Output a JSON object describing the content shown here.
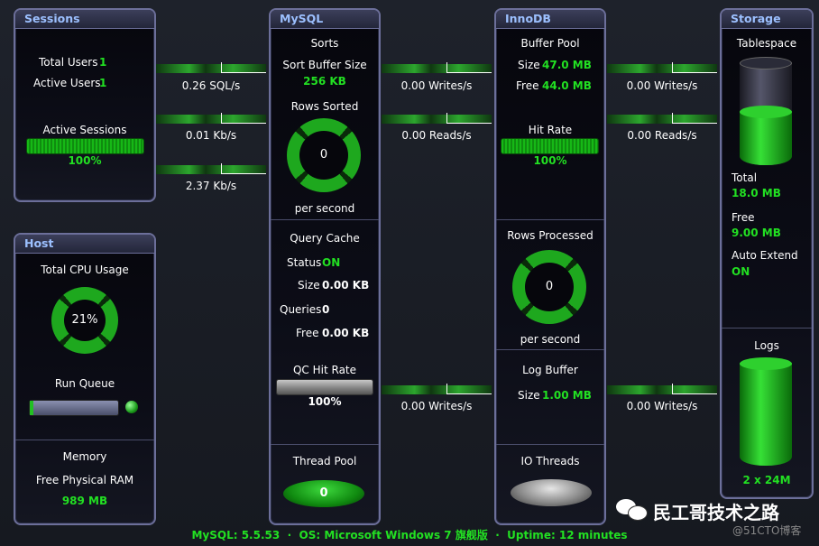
{
  "sessions": {
    "title": "Sessions",
    "total_users_label": "Total Users",
    "total_users": "1",
    "active_users_label": "Active Users",
    "active_users": "1",
    "active_sessions_label": "Active Sessions",
    "active_sessions": "100%",
    "active_sessions_fraction": 1.0
  },
  "connectors_left": [
    "0.26 SQL/s",
    "0.01 Kb/s",
    "2.37 Kb/s"
  ],
  "host": {
    "title": "Host",
    "cpu_label": "Total CPU Usage",
    "cpu_value": "21%",
    "run_queue_label": "Run Queue",
    "memory_label": "Memory",
    "free_ram_label": "Free Physical RAM",
    "free_ram": "989 MB"
  },
  "mysql": {
    "title": "MySQL",
    "sorts_label": "Sorts",
    "sort_buffer_label": "Sort Buffer Size",
    "sort_buffer": "256 KB",
    "rows_sorted_label": "Rows Sorted",
    "rows_sorted": "0",
    "per_second": "per second",
    "query_cache_label": "Query Cache",
    "status_label": "Status",
    "status": "ON",
    "size_label": "Size",
    "size": "0.00 KB",
    "queries_label": "Queries",
    "queries": "0",
    "free_label": "Free",
    "free": "0.00 KB",
    "qc_hit_label": "QC Hit Rate",
    "qc_hit": "100%",
    "thread_pool_label": "Thread Pool",
    "thread_pool": "0"
  },
  "connectors_mid": [
    "0.00 Writes/s",
    "0.00 Reads/s",
    "0.00 Writes/s"
  ],
  "innodb": {
    "title": "InnoDB",
    "buffer_pool_label": "Buffer Pool",
    "size_label": "Size",
    "size": "47.0 MB",
    "free_label": "Free",
    "free": "44.0 MB",
    "hit_rate_label": "Hit Rate",
    "hit_rate": "100%",
    "rows_processed_label": "Rows Processed",
    "rows_processed": "0",
    "per_second": "per second",
    "log_buffer_label": "Log Buffer",
    "log_size_label": "Size",
    "log_size": "1.00 MB",
    "io_threads_label": "IO Threads"
  },
  "connectors_right": [
    "0.00 Writes/s",
    "0.00 Reads/s",
    "0.00 Writes/s"
  ],
  "storage": {
    "title": "Storage",
    "tablespace_label": "Tablespace",
    "total_label": "Total",
    "total": "18.0 MB",
    "free_label": "Free",
    "free": "9.00 MB",
    "auto_extend_label": "Auto Extend",
    "auto_extend": "ON",
    "logs_label": "Logs",
    "logs": "2 x 24M"
  },
  "footer": {
    "mysql": "MySQL: 5.5.53",
    "os": "OS: Microsoft Windows 7 旗舰版",
    "uptime": "Uptime: 12 minutes",
    "sep": "·"
  },
  "watermark": {
    "text": "民工哥技术之路",
    "sub": "@51CTO博客"
  },
  "colors": {
    "accent_green": "#22e022",
    "title_blue": "#9cc0ff",
    "border": "#6c6f9a"
  }
}
